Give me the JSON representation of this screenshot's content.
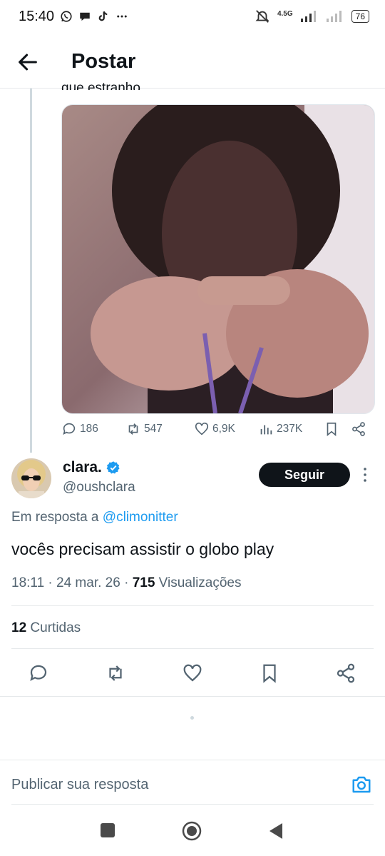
{
  "status_bar": {
    "time": "15:40",
    "network": "4.5G",
    "battery": "76",
    "left_icons": [
      "whatsapp-icon",
      "chat-icon",
      "tiktok-icon",
      "more-dots-icon"
    ],
    "right_icons": [
      "mute-icon",
      "signal-icon",
      "signal-icon",
      "battery-icon"
    ]
  },
  "header": {
    "title": "Postar",
    "back_icon": "arrow-left-icon"
  },
  "parent_tweet": {
    "text_cut": "que estranho",
    "media_alt": "video thumbnail",
    "replies": "186",
    "retweets": "547",
    "likes": "6,9K",
    "views": "237K"
  },
  "main_tweet": {
    "name": "clara.",
    "verified": true,
    "handle": "@oushclara",
    "follow_label": "Seguir",
    "reply_prefix": "Em resposta a",
    "reply_mention": "@climonitter",
    "text": "vocês precisam assistir o globo play",
    "time": "18:11 · 24 mar. 26 ·",
    "views_count": "715",
    "views_label": "Visualizações",
    "likes_count": "12",
    "likes_label": "Curtidas"
  },
  "reply_bar": {
    "placeholder": "Publicar sua resposta"
  },
  "colors": {
    "accent": "#1d9bf0",
    "text": "#0f1419",
    "muted": "#536471",
    "follow_bg": "#0f1419"
  }
}
